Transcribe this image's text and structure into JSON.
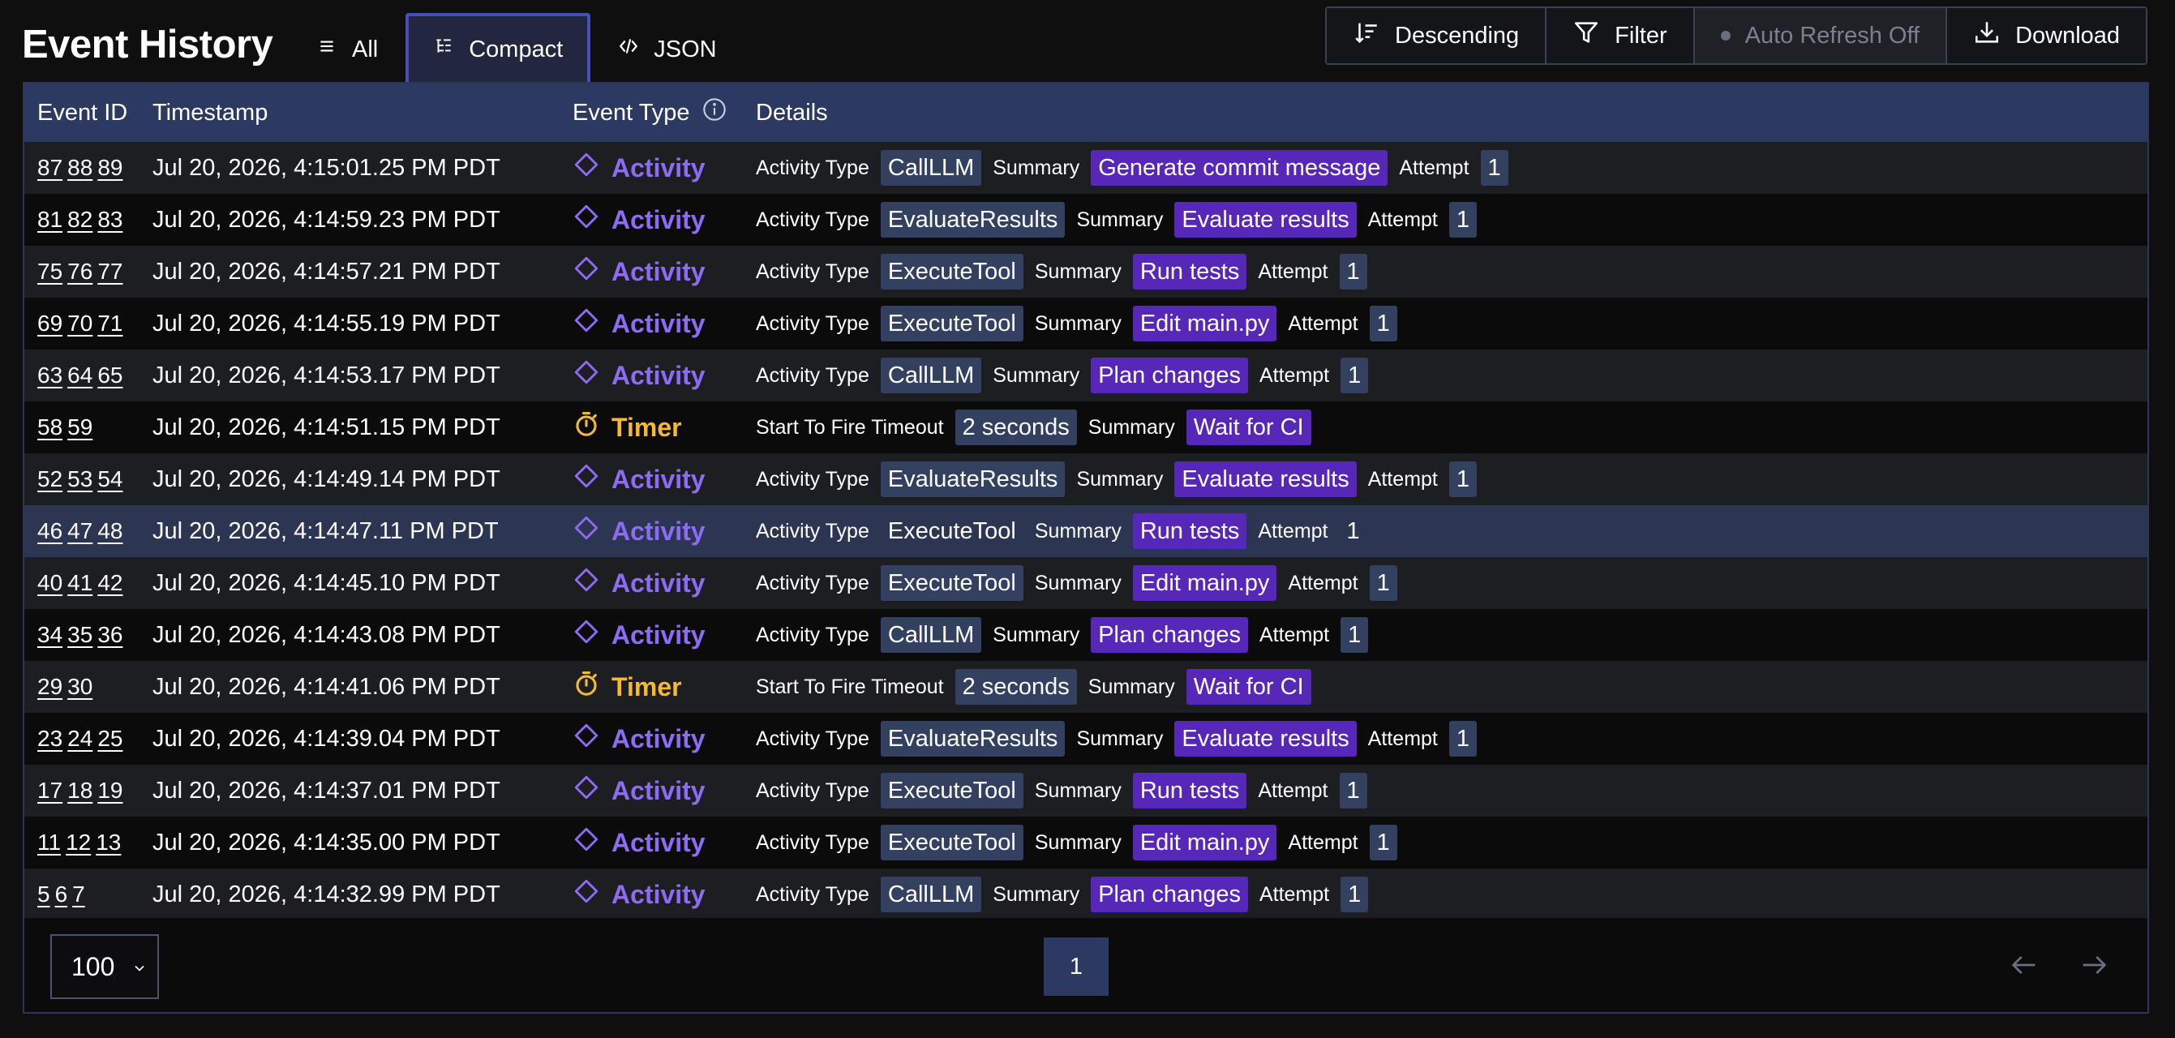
{
  "page_title": "Event History",
  "view_tabs": [
    {
      "label": "All",
      "icon": "list-icon"
    },
    {
      "label": "Compact",
      "icon": "compact-list-icon",
      "active": true
    },
    {
      "label": "JSON",
      "icon": "code-icon"
    }
  ],
  "toolbar": {
    "sort_label": "Descending",
    "filter_label": "Filter",
    "auto_refresh_label": "Auto Refresh Off",
    "download_label": "Download"
  },
  "columns": {
    "event_id": "Event ID",
    "timestamp": "Timestamp",
    "event_type": "Event Type",
    "details": "Details"
  },
  "detail_labels": {
    "activity_type": "Activity Type",
    "summary": "Summary",
    "attempt": "Attempt",
    "start_to_fire": "Start To Fire Timeout"
  },
  "rows": [
    {
      "ids": [
        "87",
        "88",
        "89"
      ],
      "timestamp": "Jul 20, 2026, 4:15:01.25 PM PDT",
      "type": "Activity",
      "activity_type": "CallLLM",
      "summary": "Generate commit message",
      "attempt": "1"
    },
    {
      "ids": [
        "81",
        "82",
        "83"
      ],
      "timestamp": "Jul 20, 2026, 4:14:59.23 PM PDT",
      "type": "Activity",
      "activity_type": "EvaluateResults",
      "summary": "Evaluate results",
      "attempt": "1"
    },
    {
      "ids": [
        "75",
        "76",
        "77"
      ],
      "timestamp": "Jul 20, 2026, 4:14:57.21 PM PDT",
      "type": "Activity",
      "activity_type": "ExecuteTool",
      "summary": "Run tests",
      "attempt": "1"
    },
    {
      "ids": [
        "69",
        "70",
        "71"
      ],
      "timestamp": "Jul 20, 2026, 4:14:55.19 PM PDT",
      "type": "Activity",
      "activity_type": "ExecuteTool",
      "summary": "Edit main.py",
      "attempt": "1"
    },
    {
      "ids": [
        "63",
        "64",
        "65"
      ],
      "timestamp": "Jul 20, 2026, 4:14:53.17 PM PDT",
      "type": "Activity",
      "activity_type": "CallLLM",
      "summary": "Plan changes",
      "attempt": "1"
    },
    {
      "ids": [
        "58",
        "59"
      ],
      "timestamp": "Jul 20, 2026, 4:14:51.15 PM PDT",
      "type": "Timer",
      "timeout": "2 seconds",
      "summary": "Wait for CI"
    },
    {
      "ids": [
        "52",
        "53",
        "54"
      ],
      "timestamp": "Jul 20, 2026, 4:14:49.14 PM PDT",
      "type": "Activity",
      "activity_type": "EvaluateResults",
      "summary": "Evaluate results",
      "attempt": "1"
    },
    {
      "ids": [
        "46",
        "47",
        "48"
      ],
      "timestamp": "Jul 20, 2026, 4:14:47.11 PM PDT",
      "type": "Activity",
      "activity_type": "ExecuteTool",
      "summary": "Run tests",
      "attempt": "1",
      "selected": true
    },
    {
      "ids": [
        "40",
        "41",
        "42"
      ],
      "timestamp": "Jul 20, 2026, 4:14:45.10 PM PDT",
      "type": "Activity",
      "activity_type": "ExecuteTool",
      "summary": "Edit main.py",
      "attempt": "1"
    },
    {
      "ids": [
        "34",
        "35",
        "36"
      ],
      "timestamp": "Jul 20, 2026, 4:14:43.08 PM PDT",
      "type": "Activity",
      "activity_type": "CallLLM",
      "summary": "Plan changes",
      "attempt": "1"
    },
    {
      "ids": [
        "29",
        "30"
      ],
      "timestamp": "Jul 20, 2026, 4:14:41.06 PM PDT",
      "type": "Timer",
      "timeout": "2 seconds",
      "summary": "Wait for CI"
    },
    {
      "ids": [
        "23",
        "24",
        "25"
      ],
      "timestamp": "Jul 20, 2026, 4:14:39.04 PM PDT",
      "type": "Activity",
      "activity_type": "EvaluateResults",
      "summary": "Evaluate results",
      "attempt": "1"
    },
    {
      "ids": [
        "17",
        "18",
        "19"
      ],
      "timestamp": "Jul 20, 2026, 4:14:37.01 PM PDT",
      "type": "Activity",
      "activity_type": "ExecuteTool",
      "summary": "Run tests",
      "attempt": "1"
    },
    {
      "ids": [
        "11",
        "12",
        "13"
      ],
      "timestamp": "Jul 20, 2026, 4:14:35.00 PM PDT",
      "type": "Activity",
      "activity_type": "ExecuteTool",
      "summary": "Edit main.py",
      "attempt": "1"
    },
    {
      "ids": [
        "5",
        "6",
        "7"
      ],
      "timestamp": "Jul 20, 2026, 4:14:32.99 PM PDT",
      "type": "Activity",
      "activity_type": "CallLLM",
      "summary": "Plan changes",
      "attempt": "1"
    }
  ],
  "pagination": {
    "page_size": "100",
    "current_page": "1"
  },
  "colors": {
    "activity": "#8d6cf5",
    "timer": "#f5b936",
    "header_bg": "#2c3a62",
    "summary_tag": "#5727b8",
    "code_tag": "#344060"
  }
}
